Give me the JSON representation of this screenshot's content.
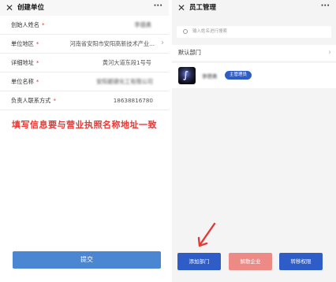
{
  "left": {
    "title": "创建单位",
    "more": "···",
    "close": "✕",
    "fields": [
      {
        "label": "创始人姓名",
        "value": "李德勇",
        "blurred": true,
        "chevron": false
      },
      {
        "label": "单位地区",
        "value": "河南省安阳市安阳高新技术产业...",
        "blurred": false,
        "chevron": true
      },
      {
        "label": "详细地址",
        "value": "黄河大道东段1号号",
        "blurred": false,
        "chevron": false
      },
      {
        "label": "单位名称",
        "value": "安阳碧建化工有限公司",
        "blurred": true,
        "chevron": false
      },
      {
        "label": "负责人联系方式",
        "value": "18638816780",
        "blurred": false,
        "chevron": false
      }
    ],
    "required_mark": "*",
    "annotation": "填写信息要与营业执照名称地址一致",
    "submit_label": "提交"
  },
  "right": {
    "title": "员工管理",
    "more": "···",
    "close": "✕",
    "search_placeholder": "输入姓名进行搜索",
    "default_department": "默认部门",
    "member_name": "李德勇",
    "member_badge": "主管理员",
    "buttons": {
      "add_department": "添加部门",
      "dissolve": "解散企业",
      "transfer": "转移权限"
    }
  },
  "colors": {
    "accent_blue": "#2f5dc8",
    "submit_blue": "#4a86d2",
    "dissolve_pink": "#ee8a86",
    "annotation_red": "#e53935"
  }
}
